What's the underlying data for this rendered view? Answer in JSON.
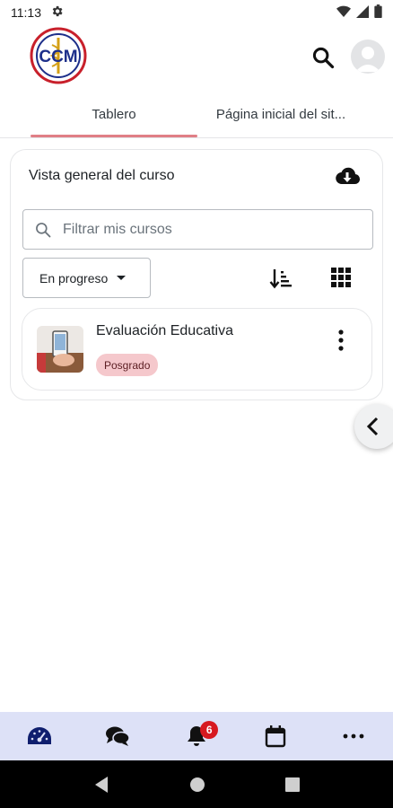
{
  "status_bar": {
    "time": "11:13"
  },
  "header": {
    "logo_text": "CCM"
  },
  "tabs": [
    {
      "label": "Tablero",
      "active": true
    },
    {
      "label": "Página inicial del sit..."
    }
  ],
  "course_overview": {
    "title": "Vista general del curso",
    "filter_placeholder": "Filtrar mis cursos",
    "filter_value": "",
    "status_filter": "En progreso",
    "courses": [
      {
        "name": "Evaluación Educativa",
        "category": "Posgrado"
      }
    ]
  },
  "bottom_nav": {
    "items": [
      {
        "icon": "dashboard-icon",
        "active": true
      },
      {
        "icon": "messages-icon"
      },
      {
        "icon": "notifications-icon",
        "badge": "6"
      },
      {
        "icon": "calendar-icon"
      },
      {
        "icon": "more-icon"
      }
    ]
  },
  "colors": {
    "accent": "#e07f86",
    "nav_background": "#dde1f7",
    "nav_active": "#0f1e6e",
    "badge_background": "#f5c8cc",
    "notification_badge": "#d71920"
  }
}
